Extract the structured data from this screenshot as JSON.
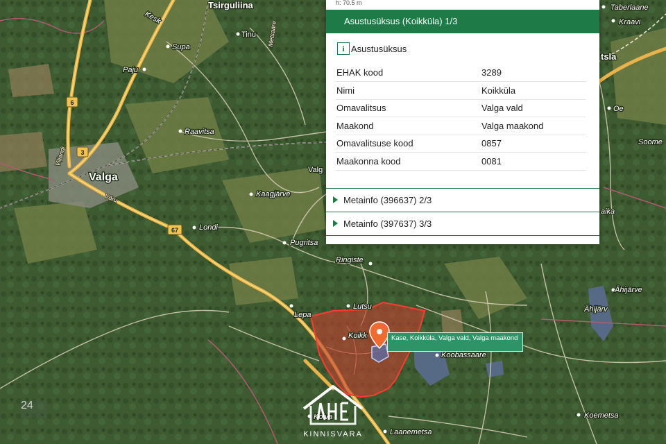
{
  "panel": {
    "top_text": "h: 70.5 m",
    "header": "Asustusüksus (Koikküla) 1/3",
    "section_icon": "info-icon",
    "section_title": "Asustusüksus",
    "rows": [
      {
        "key": "EHAK kood",
        "value": "3289"
      },
      {
        "key": "Nimi",
        "value": "Koikküla"
      },
      {
        "key": "Omavalitsus",
        "value": "Valga vald"
      },
      {
        "key": "Maakond",
        "value": "Valga maakond"
      },
      {
        "key": "Omavalitsuse kood",
        "value": "0857"
      },
      {
        "key": "Maakonna kood",
        "value": "0081"
      }
    ],
    "collapsed": [
      {
        "label": "Metainfo (396637) 2/3"
      },
      {
        "label": "Metainfo (397637) 3/3"
      }
    ]
  },
  "popup": {
    "text": "Kase, Koikküla, Valga vald, Valga maakond",
    "icon": "map-marker-icon"
  },
  "map": {
    "places": {
      "tsirguliina": "Tsirguliina",
      "kesk": "Kesk",
      "tinu": "Tinu",
      "supa": "Supa",
      "paju": "Paju",
      "raavitsa": "Raavitsa",
      "valga": "Valga",
      "kaagjarve": "Kaagjärve",
      "londi": "Londi",
      "pugritsa": "Pugritsa",
      "ringiste": "Ringiste",
      "lutsu": "Lutsu",
      "lepa": "Lepa",
      "koikkula": "Koikk",
      "koobassaare": "Koobassaare",
      "koiva": "Koiva",
      "laanemetsa": "Laanemetsa",
      "taberlaane": "Taberlaane",
      "kraavi": "Kraavi",
      "tsla": "tsla",
      "oe": "Oe",
      "soome": "Soome",
      "aika": "aika",
      "ahijarve": "Ähijärve",
      "ahijarv": "Ähijärv",
      "koemetsa": "Koemetsa",
      "valg_partial": "Valg",
      "metsaare": "Metsaäre",
      "viljandi": "Viljandi",
      "voru": "Võru"
    },
    "road_numbers": {
      "r6": "6",
      "r3": "3",
      "r67": "67"
    },
    "badge": "24",
    "logo_text": "KINNISVARA",
    "logo_mark": "LAHE",
    "colors": {
      "parcel_fill": "#c0402f",
      "parcel_stroke": "#ff3b30",
      "accent": "#1e7a46",
      "road": "#e9b24a",
      "marker": "#ef6b2f"
    }
  }
}
